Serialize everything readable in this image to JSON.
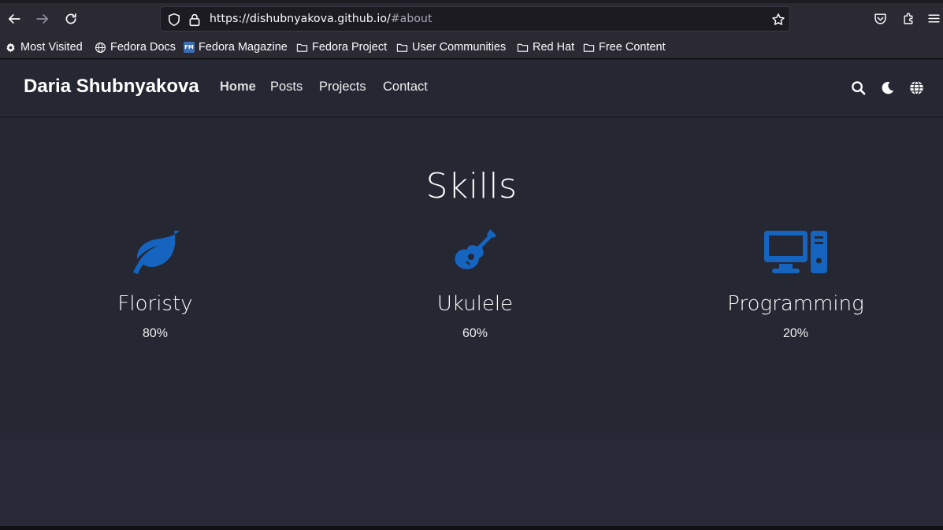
{
  "browser": {
    "url_host": "https://dishubnyakova.github.io/",
    "url_fragment": "#about",
    "bookmarks": [
      {
        "label": "Most Visited",
        "icon": "gear-icon"
      },
      {
        "label": "Fedora Docs",
        "icon": "globe-icon"
      },
      {
        "label": "Fedora Magazine",
        "icon": "fedora-magazine-icon"
      },
      {
        "label": "Fedora Project",
        "icon": "folder-icon"
      },
      {
        "label": "User Communities",
        "icon": "folder-icon"
      },
      {
        "label": "Red Hat",
        "icon": "folder-icon"
      },
      {
        "label": "Free Content",
        "icon": "folder-icon"
      }
    ],
    "fm_badge": "FM"
  },
  "site": {
    "brand": "Daria Shubnyakova",
    "menu": [
      {
        "label": "Home",
        "active": true
      },
      {
        "label": "Posts",
        "active": false
      },
      {
        "label": "Projects",
        "active": false
      },
      {
        "label": "Contact",
        "active": false
      }
    ]
  },
  "skills": {
    "title": "Skills",
    "accent": "#1565c0",
    "items": [
      {
        "name": "Floristy",
        "percent": "80%",
        "icon": "leaf-icon"
      },
      {
        "name": "Ukulele",
        "percent": "60%",
        "icon": "guitar-icon"
      },
      {
        "name": "Programming",
        "percent": "20%",
        "icon": "desktop-icon"
      }
    ]
  }
}
